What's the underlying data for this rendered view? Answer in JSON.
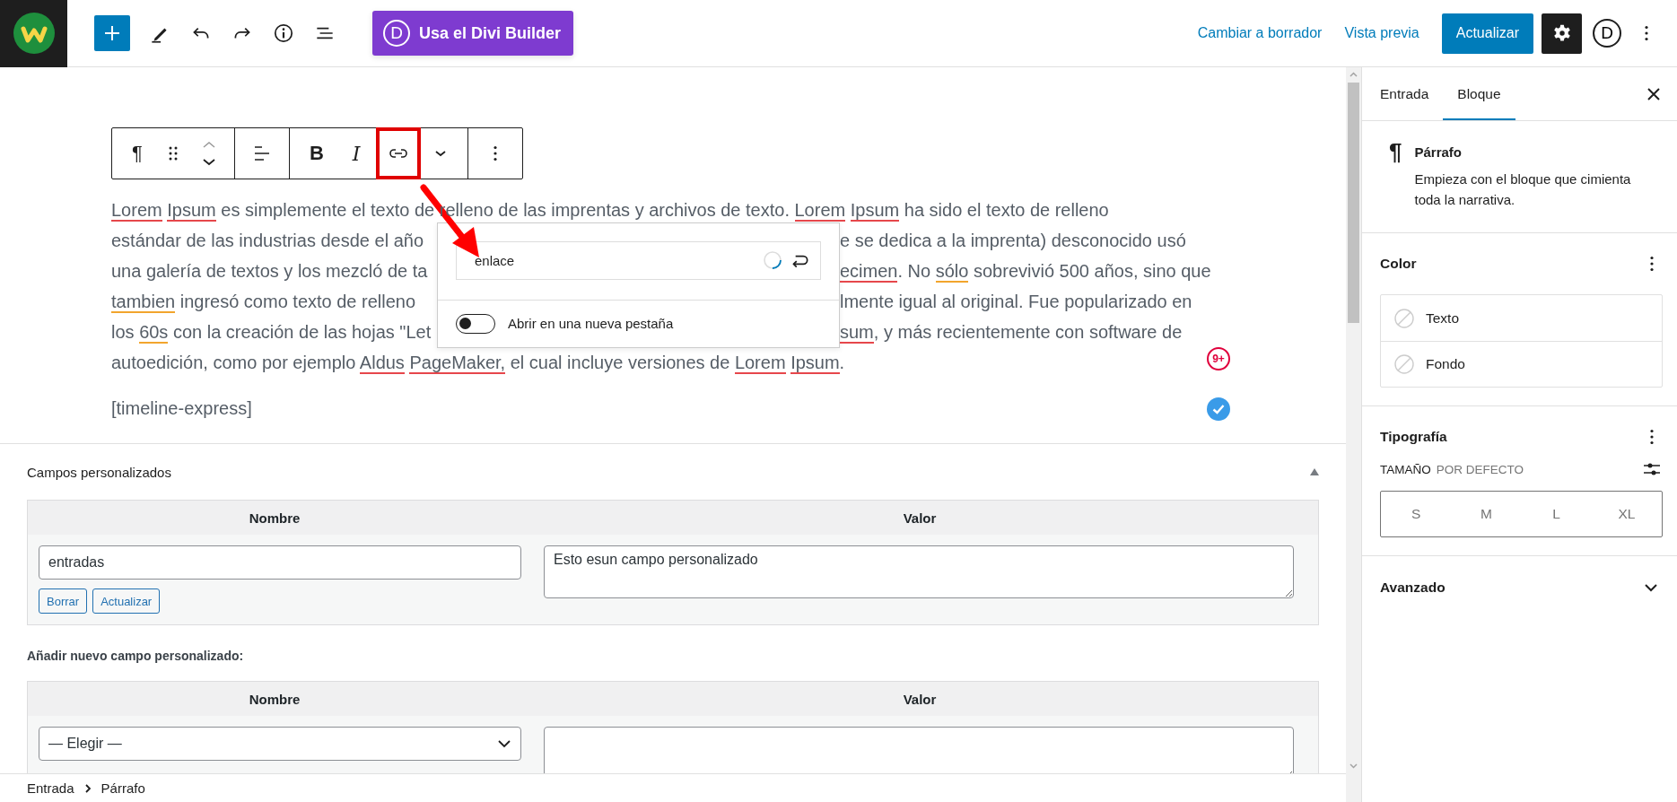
{
  "top_bar": {
    "add_selected": true,
    "divi_button": {
      "badge": "D",
      "label": "Usa el Divi Builder"
    },
    "links": [
      "Cambiar a borrador",
      "Vista previa"
    ],
    "update_button": "Actualizar",
    "settings_on": true,
    "divi_icon": "D"
  },
  "block_toolbar": {
    "groups": [
      [
        {
          "kind": "paragraph",
          "label": "¶",
          "highlighted": false
        },
        {
          "kind": "drag",
          "highlighted": false
        },
        {
          "kind": "move",
          "highlighted": false
        }
      ],
      [
        {
          "kind": "align",
          "highlighted": false
        }
      ],
      [
        {
          "kind": "bold",
          "label": "B",
          "highlighted": false
        },
        {
          "kind": "italic",
          "label": "I",
          "highlighted": false
        },
        {
          "kind": "link",
          "highlighted": true
        },
        {
          "kind": "more",
          "highlighted": false
        }
      ],
      [
        {
          "kind": "options",
          "highlighted": false
        }
      ]
    ]
  },
  "paragraph": {
    "lines": [
      {
        "full": [
          {
            "text": "Lorem Ipsum",
            "kind": "spelling"
          },
          {
            "text": " es simplemente el texto de relleno de las imprentas y archivos de texto. ",
            "kind": "plain"
          },
          {
            "text": "Lorem Ipsum",
            "kind": "spelling"
          },
          {
            "text": " ha sido el texto de relleno",
            "kind": "plain"
          }
        ]
      },
      {
        "left": [
          {
            "text": "estándar de las industrias desde el año",
            "kind": "plain"
          }
        ],
        "right": [
          {
            "text": "e se dedica a la imprenta) desconocido usó",
            "kind": "plain"
          }
        ]
      },
      {
        "left": [
          {
            "text": "una galería de textos y los mezcló de ta",
            "kind": "plain"
          }
        ],
        "right": [
          {
            "text": "ecimen",
            "kind": "spelling"
          },
          {
            "text": ". No ",
            "kind": "plain"
          },
          {
            "text": "sólo",
            "kind": "grammar"
          },
          {
            "text": " sobrevivió 500 años, sino que",
            "kind": "plain"
          }
        ]
      },
      {
        "left": [
          {
            "text": "tambien",
            "kind": "grammar"
          },
          {
            "text": " ingresó como texto de relleno",
            "kind": "plain"
          }
        ],
        "right": [
          {
            "text": "lmente igual al original. Fue popularizado en",
            "kind": "plain"
          }
        ]
      },
      {
        "left": [
          {
            "text": "los ",
            "kind": "plain"
          },
          {
            "text": "60s",
            "kind": "grammar"
          },
          {
            "text": " con la creación de las hojas \"Let",
            "kind": "plain"
          }
        ],
        "right": [
          {
            "text": "sum",
            "kind": "spelling"
          },
          {
            "text": ", y más recientemente con software de",
            "kind": "plain"
          }
        ]
      },
      {
        "full": [
          {
            "text": "autoedición, como por ejemplo ",
            "kind": "plain"
          },
          {
            "text": "Aldus PageMaker,",
            "kind": "spelling"
          },
          {
            "text": " el cual incluye versiones de ",
            "kind": "plain"
          },
          {
            "text": "Lorem Ipsum",
            "kind": "spelling"
          },
          {
            "text": ".",
            "kind": "plain"
          }
        ]
      }
    ],
    "badge": "9+"
  },
  "shortcode": "[timeline-express]",
  "link_popup": {
    "value": "enlace",
    "loading": true,
    "new_tab_label": "Abrir en una nueva pestaña",
    "new_tab_on": false
  },
  "custom_fields": {
    "title": "Campos personalizados",
    "expanded": true,
    "columns": [
      "Nombre",
      "Valor"
    ],
    "rows": [
      {
        "name": "entradas",
        "value": "Esto esun campo personalizado",
        "buttons": [
          "Borrar",
          "Actualizar"
        ]
      }
    ],
    "add_title": "Añadir nuevo campo personalizado:",
    "add_columns": [
      "Nombre",
      "Valor"
    ],
    "add_select": "— Elegir —"
  },
  "breadcrumb": [
    "Entrada",
    "Párrafo"
  ],
  "sidebar": {
    "tabs": [
      {
        "label": "Entrada",
        "selected": false
      },
      {
        "label": "Bloque",
        "selected": true
      }
    ],
    "block": {
      "icon": "¶",
      "name": "Párrafo",
      "description": "Empieza con el bloque que cimienta toda la narrativa."
    },
    "color": {
      "title": "Color",
      "items": [
        "Texto",
        "Fondo"
      ]
    },
    "typography": {
      "title": "Tipografía",
      "size_label": "TAMAÑO",
      "size_value": "POR DEFECTO",
      "sizes": [
        {
          "label": "S",
          "selected": false
        },
        {
          "label": "M",
          "selected": false
        },
        {
          "label": "L",
          "selected": false
        },
        {
          "label": "XL",
          "selected": false
        }
      ]
    },
    "advanced": {
      "title": "Avanzado",
      "expanded": false
    }
  }
}
